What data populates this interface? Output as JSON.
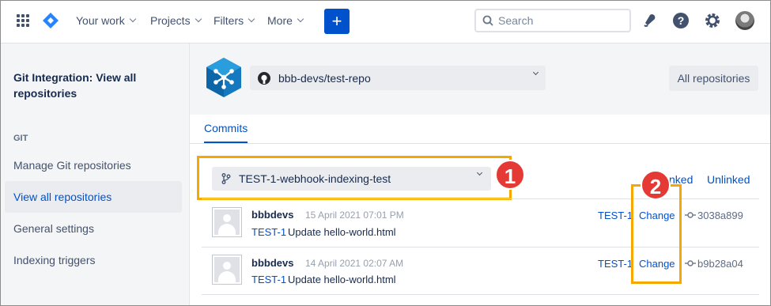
{
  "topnav": {
    "your_work": "Your work",
    "projects": "Projects",
    "filters": "Filters",
    "more": "More",
    "create": "+",
    "search_placeholder": "Search"
  },
  "sidebar": {
    "title": "Git Integration: View all repositories",
    "section": "GIT",
    "items": [
      {
        "label": "Manage Git repositories"
      },
      {
        "label": "View all repositories"
      },
      {
        "label": "General settings"
      },
      {
        "label": "Indexing triggers"
      }
    ]
  },
  "header": {
    "repo": "bbb-devs/test-repo",
    "all_repositories": "All repositories"
  },
  "tabs": {
    "commits": "Commits"
  },
  "branch": {
    "selected": "TEST-1-webhook-indexing-test"
  },
  "filters": {
    "linked": "nked",
    "unlinked": "Unlinked"
  },
  "annotations": {
    "badge1": "1",
    "badge2": "2"
  },
  "commits": [
    {
      "author": "bbbdevs",
      "date": "15 April 2021 07:01 PM",
      "issue": "TEST-1",
      "message": "Update hello-world.html",
      "key": "TEST-1",
      "change": "Change",
      "hash": "3038a899"
    },
    {
      "author": "bbbdevs",
      "date": "14 April 2021 02:07 AM",
      "issue": "TEST-1",
      "message": "Update hello-world.html",
      "key": "TEST-1",
      "change": "Change",
      "hash": "b9b28a04"
    }
  ],
  "colors": {
    "accent": "#0052cc",
    "highlight": "#f5a800",
    "badge": "#e53935"
  }
}
